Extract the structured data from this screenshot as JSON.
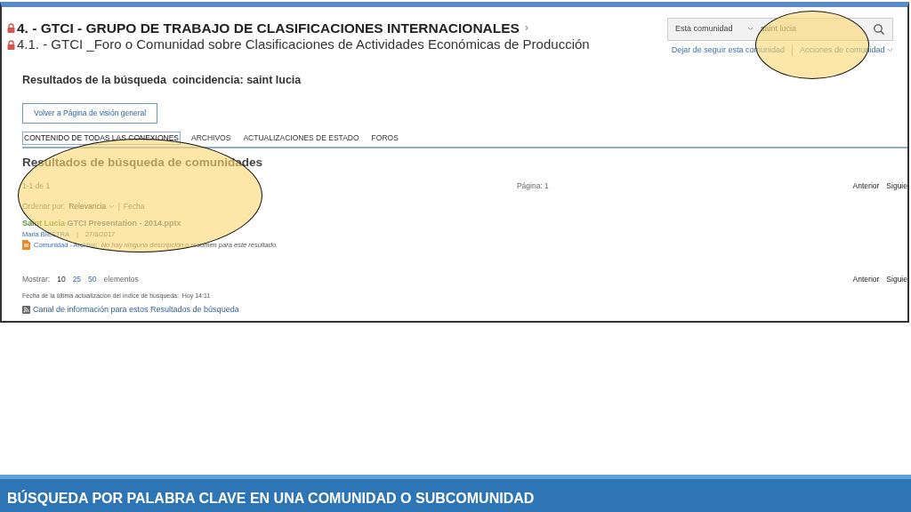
{
  "header": {
    "title": "4. - GTCI - GRUPO DE TRABAJO DE CLASIFICACIONES INTERNACIONALES",
    "title_chevron": "›",
    "subtitle": "4.1. - GTCI _Foro o Comunidad sobre Clasificaciones de Actividades Económicas de Producción"
  },
  "search": {
    "scope": "Esta comunidad",
    "value": "saint lucia"
  },
  "community_links": [
    {
      "label": "Dejar de seguir esta comunidad",
      "dropdown": false
    },
    {
      "label": "Acciones de comunidad",
      "dropdown": true
    }
  ],
  "results_heading": "Resultados de la búsqueda  coincidencia: saint lucia",
  "back_button": "Volver a Página de visión general",
  "tabs": [
    {
      "label": "CONTENIDO DE TODAS LAS CONEXIONES",
      "selected": true
    },
    {
      "label": "ARCHIVOS",
      "selected": false
    },
    {
      "label": "ACTUALIZACIONES DE ESTADO",
      "selected": false
    },
    {
      "label": "FOROS",
      "selected": false
    }
  ],
  "section_title": "Resultados de búsqueda de comunidades",
  "count": "1-1 de 1",
  "page": "Página: 1",
  "pager": [
    "Anterior",
    "Siguie"
  ],
  "sort": {
    "label": "Ordenar por:",
    "separator": "|",
    "options": [
      {
        "label": "Relevancia",
        "selected": true
      },
      {
        "label": "Fecha",
        "selected": false
      }
    ]
  },
  "results": [
    {
      "match": "Saint Lucia",
      "title_rest": "GTCI Presentation - 2014.pptx",
      "author": "Maria BIESTRA",
      "separator": "|",
      "date": "27/8/2017",
      "source": "Comunidad - Archivo:",
      "description": "No hay ninguna descripción o resumen para este resultado."
    }
  ],
  "page_size": {
    "label": "Mostrar:",
    "options": [
      {
        "label": "10",
        "selected": true
      },
      {
        "label": "25",
        "selected": false
      },
      {
        "label": "50",
        "selected": false
      }
    ],
    "suffix": "elementos"
  },
  "pager_bottom": [
    "Anterior",
    "Siguie"
  ],
  "index_date": "Fecha de la última actualización del índice de búsqueda:  Hoy 14:11",
  "feed_link": "Canal de información para estos Resultados de búsqueda",
  "highlights": [
    {
      "kind": "ellipse"
    },
    {
      "kind": "ellipse"
    }
  ],
  "slide_title": "BÚSQUEDA POR PALABRA CLAVE EN UNA COMUNIDAD O SUBCOMUNIDAD"
}
